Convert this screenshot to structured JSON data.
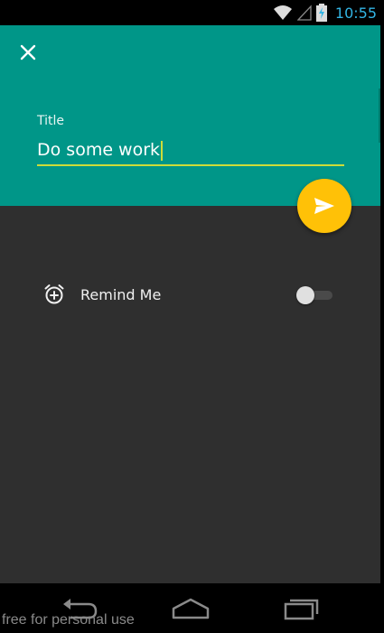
{
  "status_bar": {
    "time": "10:55",
    "icons": [
      "wifi-icon",
      "signal-icon",
      "battery-charging-icon"
    ],
    "accent": "#33b5e5"
  },
  "header": {
    "background": "#009688",
    "close_icon": "close-icon",
    "title_label": "Title",
    "title_value": "Do some work",
    "underline_color": "#cddc39"
  },
  "fab": {
    "icon": "send-icon",
    "color": "#ffc107"
  },
  "reminder": {
    "icon": "alarm-add-icon",
    "label": "Remind Me",
    "enabled": false
  },
  "nav_bar": {
    "buttons": [
      "back-icon",
      "home-icon",
      "recents-icon"
    ]
  },
  "watermark": "free for personal use"
}
